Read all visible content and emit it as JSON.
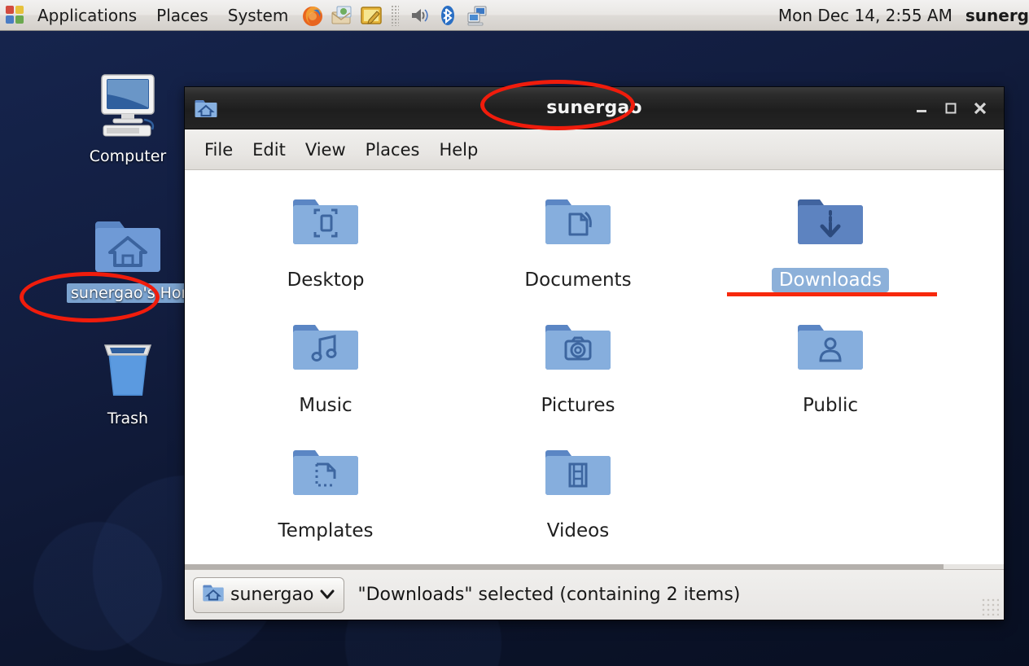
{
  "panel": {
    "apps_icon": "applications-menu-icon",
    "menus": [
      {
        "label": "Applications",
        "name": "panel-menu-applications"
      },
      {
        "label": "Places",
        "name": "panel-menu-places"
      },
      {
        "label": "System",
        "name": "panel-menu-system"
      }
    ],
    "launchers": [
      {
        "name": "firefox-icon",
        "title": "Firefox Web Browser"
      },
      {
        "name": "mail-icon",
        "title": "Evolution Mail"
      },
      {
        "name": "text-editor-icon",
        "title": "Text Editor"
      }
    ],
    "tray": [
      {
        "name": "volume-icon",
        "title": "Volume"
      },
      {
        "name": "bluetooth-icon",
        "title": "Bluetooth"
      },
      {
        "name": "network-icon",
        "title": "Network"
      }
    ],
    "clock": "Mon Dec 14,  2:55 AM",
    "user": "sunerg"
  },
  "desktop": {
    "icons": [
      {
        "name": "desktop-icon-computer",
        "label": "Computer",
        "icon": "computer-icon",
        "selected": false
      },
      {
        "name": "desktop-icon-home",
        "label": "sunergao's Home",
        "icon": "home-folder-icon",
        "selected": true
      },
      {
        "name": "desktop-icon-trash",
        "label": "Trash",
        "icon": "trash-icon",
        "selected": false
      }
    ]
  },
  "window": {
    "title": "sunergao",
    "title_icon": "home-folder-icon",
    "controls": {
      "minimize": "–",
      "maximize": "❑",
      "close": "✕"
    },
    "menubar": [
      {
        "label": "File",
        "name": "menu-file"
      },
      {
        "label": "Edit",
        "name": "menu-edit"
      },
      {
        "label": "View",
        "name": "menu-view"
      },
      {
        "label": "Places",
        "name": "menu-places"
      },
      {
        "label": "Help",
        "name": "menu-help"
      }
    ],
    "items": [
      {
        "label": "Desktop",
        "icon": "folder-desktop-icon",
        "selected": false
      },
      {
        "label": "Documents",
        "icon": "folder-documents-icon",
        "selected": false
      },
      {
        "label": "Downloads",
        "icon": "folder-downloads-icon",
        "selected": true
      },
      {
        "label": "Music",
        "icon": "folder-music-icon",
        "selected": false
      },
      {
        "label": "Pictures",
        "icon": "folder-pictures-icon",
        "selected": false
      },
      {
        "label": "Public",
        "icon": "folder-public-icon",
        "selected": false
      },
      {
        "label": "Templates",
        "icon": "folder-templates-icon",
        "selected": false
      },
      {
        "label": "Videos",
        "icon": "folder-videos-icon",
        "selected": false
      }
    ],
    "statusbar": {
      "path_button_label": "sunergao",
      "path_button_icon": "home-folder-icon",
      "path_button_chevron": "∨",
      "status_text": "\"Downloads\" selected (containing 2 items)"
    }
  },
  "annotations": {
    "color": "#f01c0c",
    "marks": [
      {
        "name": "annotation-ellipse-window-title",
        "shape": "ellipse",
        "target": "sunergao"
      },
      {
        "name": "annotation-ellipse-home-label",
        "shape": "ellipse",
        "target": "sunergao's Home"
      },
      {
        "name": "annotation-underline-downloads",
        "shape": "underline",
        "target": "Downloads"
      }
    ]
  }
}
